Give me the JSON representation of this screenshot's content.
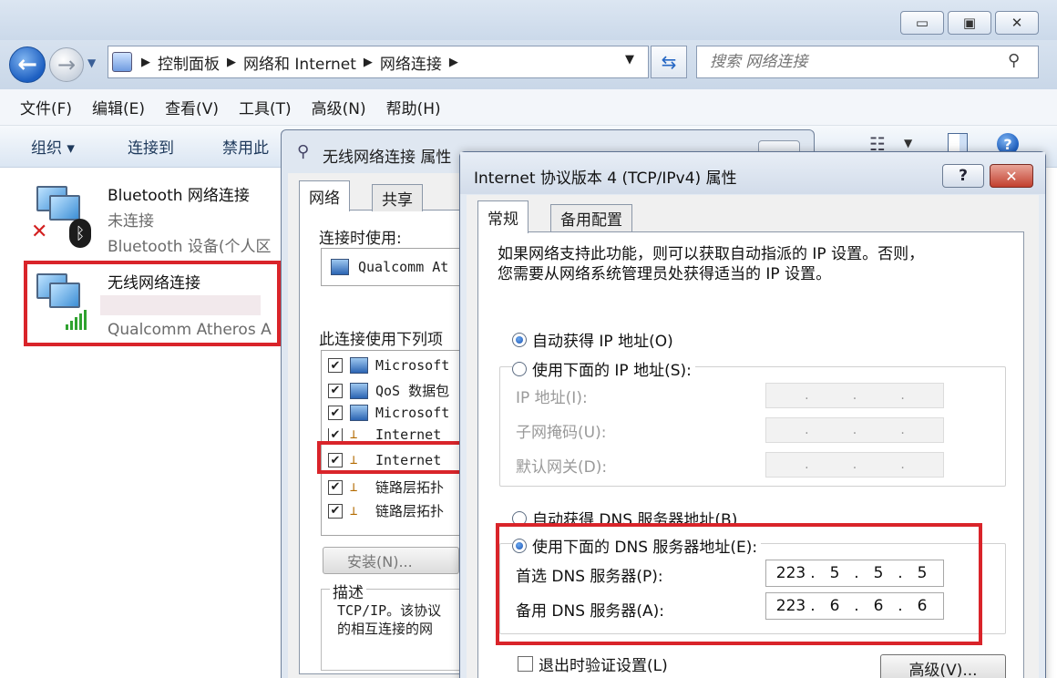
{
  "explorer": {
    "address": {
      "segments": [
        "控制面板",
        "网络和 Internet",
        "网络连接"
      ]
    },
    "search": {
      "placeholder": "搜索 网络连接"
    },
    "menu": [
      "文件(F)",
      "编辑(E)",
      "查看(V)",
      "工具(T)",
      "高级(N)",
      "帮助(H)"
    ],
    "commands": {
      "organize": "组织 ▾",
      "connect": "连接到",
      "disable": "禁用此"
    },
    "connections": [
      {
        "name": "Bluetooth 网络连接",
        "status": "未连接",
        "device": "Bluetooth 设备(个人区"
      },
      {
        "name": "无线网络连接",
        "status": "",
        "device": "Qualcomm Atheros A"
      }
    ]
  },
  "props_dialog": {
    "title": "无线网络连接 属性",
    "tabs": [
      "网络",
      "共享"
    ],
    "connect_using_label": "连接时使用:",
    "adapter": "Qualcomm At",
    "items_label": "此连接使用下列项",
    "items": [
      {
        "label": "Microsoft",
        "checked": true,
        "icon": "network-client-icon"
      },
      {
        "label": "QoS 数据包",
        "checked": true,
        "icon": "qos-icon"
      },
      {
        "label": "Microsoft",
        "checked": true,
        "icon": "network-client-icon"
      },
      {
        "label": "Internet",
        "checked": true,
        "icon": "protocol-icon"
      },
      {
        "label": "Internet",
        "checked": true,
        "icon": "protocol-icon"
      },
      {
        "label": "链路层拓扑",
        "checked": true,
        "icon": "protocol-icon"
      },
      {
        "label": "链路层拓扑",
        "checked": true,
        "icon": "protocol-icon"
      }
    ],
    "install_label": "安装(N)...",
    "description_legend": "描述",
    "description_lines": [
      "TCP/IP。该协议",
      "的相互连接的网"
    ]
  },
  "ipv4_dialog": {
    "title": "Internet 协议版本 4 (TCP/IPv4) 属性",
    "help_label": "?",
    "close_label": "✕",
    "tabs": [
      "常规",
      "备用配置"
    ],
    "intro_lines": [
      "如果网络支持此功能，则可以获取自动指派的 IP 设置。否则，",
      "您需要从网络系统管理员处获得适当的 IP 设置。"
    ],
    "auto_ip_label": "自动获得 IP 地址(O)",
    "manual_ip_label": "使用下面的 IP 地址(S):",
    "ip_fields": {
      "ip_label": "IP 地址(I):",
      "mask_label": "子网掩码(U):",
      "gateway_label": "默认网关(D):"
    },
    "auto_dns_label": "自动获得 DNS 服务器地址(B)",
    "manual_dns_label": "使用下面的 DNS 服务器地址(E):",
    "preferred_dns_label": "首选 DNS 服务器(P):",
    "alternate_dns_label": "备用 DNS 服务器(A):",
    "preferred_dns": [
      "223",
      "5",
      "5",
      "5"
    ],
    "alternate_dns": [
      "223",
      "6",
      "6",
      "6"
    ],
    "validate_label": "退出时验证设置(L)",
    "advanced_label": "高级(V)...",
    "selected_ip_mode": "auto",
    "selected_dns_mode": "manual"
  },
  "colors": {
    "highlight": "#d9242a",
    "accent": "#1d5fc1"
  }
}
